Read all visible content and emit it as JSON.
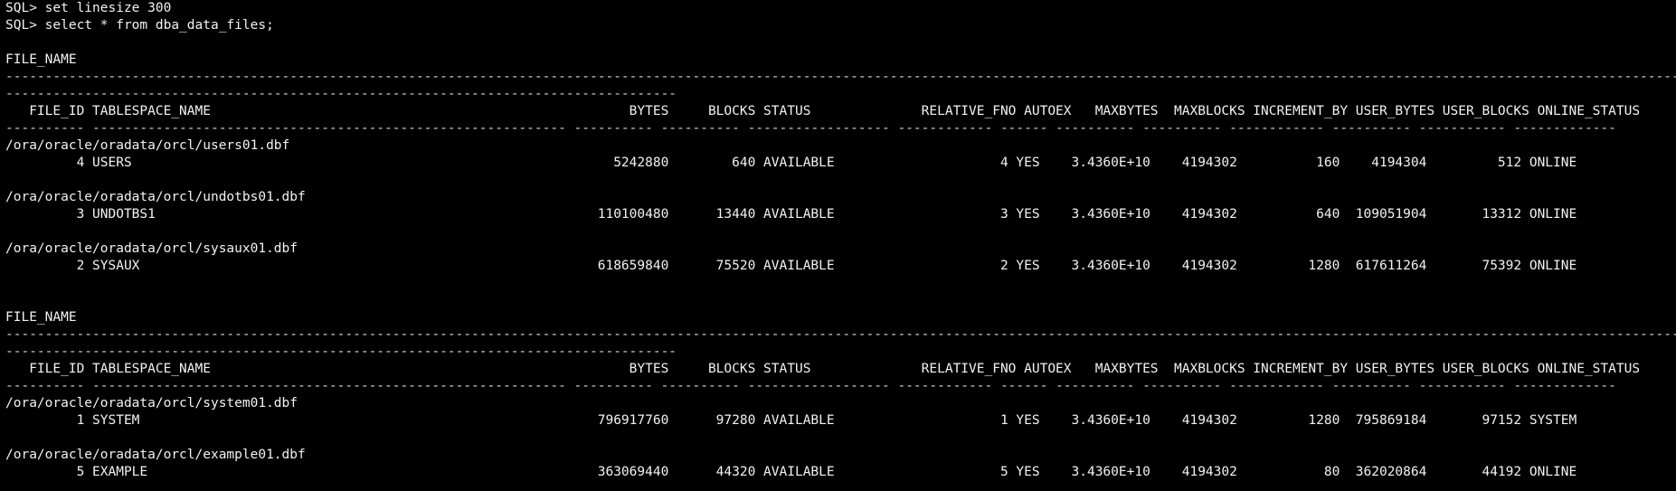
{
  "terminal": {
    "lines": [
      "SQL> set linesize 300",
      "SQL> select * from dba_data_files;",
      "",
      "FILE_NAME",
      "------------------------------------------------------------------------------------------------------------------------------------------------------------------------------------------------------------------------------------------",
      "-------------------------------------------------------------------------------------",
      "   FILE_ID TABLESPACE_NAME                                                     BYTES     BLOCKS STATUS              RELATIVE_FNO AUTOEX   MAXBYTES  MAXBLOCKS INCREMENT_BY USER_BYTES USER_BLOCKS ONLINE_STATUS",
      "---------- ------------------------------------------------------------ ---------- ---------- ------------------ ------------ ------ ---------- ---------- ------------ ---------- ----------- -------------",
      "/ora/oracle/oradata/orcl/users01.dbf",
      "         4 USERS                                                             5242880        640 AVAILABLE                     4 YES    3.4360E+10    4194302          160    4194304         512 ONLINE",
      "",
      "/ora/oracle/oradata/orcl/undotbs01.dbf",
      "         3 UNDOTBS1                                                        110100480      13440 AVAILABLE                     3 YES    3.4360E+10    4194302          640  109051904       13312 ONLINE",
      "",
      "/ora/oracle/oradata/orcl/sysaux01.dbf",
      "         2 SYSAUX                                                          618659840      75520 AVAILABLE                     2 YES    3.4360E+10    4194302         1280  617611264       75392 ONLINE",
      "",
      "",
      "FILE_NAME",
      "------------------------------------------------------------------------------------------------------------------------------------------------------------------------------------------------------------------------------------------",
      "-------------------------------------------------------------------------------------",
      "   FILE_ID TABLESPACE_NAME                                                     BYTES     BLOCKS STATUS              RELATIVE_FNO AUTOEX   MAXBYTES  MAXBLOCKS INCREMENT_BY USER_BYTES USER_BLOCKS ONLINE_STATUS",
      "---------- ------------------------------------------------------------ ---------- ---------- ------------------ ------------ ------ ---------- ---------- ------------ ---------- ----------- -------------",
      "/ora/oracle/oradata/orcl/system01.dbf",
      "         1 SYSTEM                                                          796917760      97280 AVAILABLE                     1 YES    3.4360E+10    4194302         1280  795869184       97152 SYSTEM",
      "",
      "/ora/oracle/oradata/orcl/example01.dbf",
      "         5 EXAMPLE                                                         363069440      44320 AVAILABLE                     5 YES    3.4360E+10    4194302           80  362020864       44192 ONLINE",
      ""
    ]
  }
}
